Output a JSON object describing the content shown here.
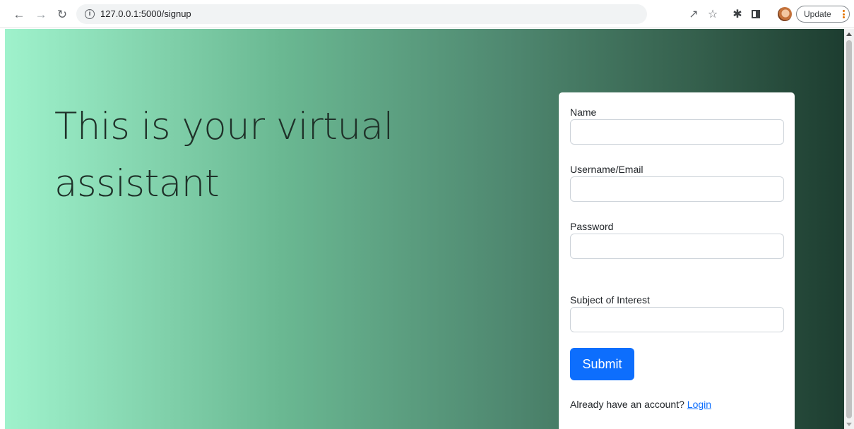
{
  "browser": {
    "url": "127.0.0.1:5000/signup",
    "update_label": "Update"
  },
  "hero": {
    "line1": "This is your virtual",
    "line2": "assistant"
  },
  "form": {
    "name_label": "Name",
    "name_value": "",
    "username_label": "Username/Email",
    "username_value": "",
    "password_label": "Password",
    "password_value": "",
    "subject_label": "Subject of Interest",
    "subject_value": "",
    "submit_label": "Submit",
    "login_prompt": "Already have an account?",
    "login_link": "Login"
  },
  "colors": {
    "accent": "#0d6efd",
    "gradient_start": "#9ff2cc",
    "gradient_end": "#1d3d30"
  }
}
